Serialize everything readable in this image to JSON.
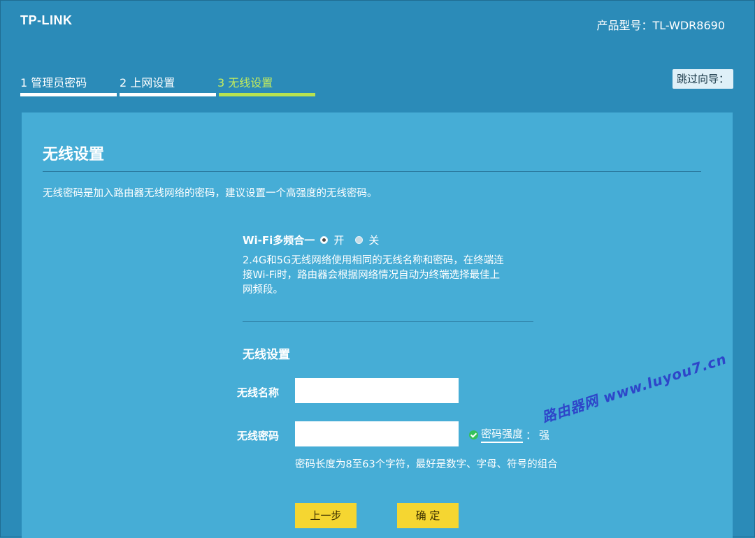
{
  "header": {
    "logo": "TP-LINK",
    "model": "产品型号：TL-WDR8690",
    "skip_label": "跳过向导："
  },
  "steps": [
    {
      "label": "1 管理员密码",
      "active": false
    },
    {
      "label": "2 上网设置",
      "active": false
    },
    {
      "label": "3 无线设置",
      "active": true
    }
  ],
  "panel": {
    "title": "无线设置",
    "description": "无线密码是加入路由器无线网络的密码，建议设置一个高强度的无线密码。",
    "wifi_merge": {
      "label": "Wi-Fi多频合一",
      "options": [
        {
          "label": "开",
          "checked": true
        },
        {
          "label": "关",
          "checked": false
        }
      ],
      "description": "2.4G和5G无线网络使用相同的无线名称和密码，在终端连接Wi-Fi时，路由器会根据网络情况自动为终端选择最佳上网频段。"
    },
    "wireless_section_title": "无线设置",
    "ssid": {
      "label": "无线名称",
      "value": ""
    },
    "password": {
      "label": "无线密码",
      "value": ""
    },
    "strength": {
      "key": "密码强度",
      "sep": "：",
      "value": "强"
    },
    "password_hint": "密码长度为8至63个字符，最好是数字、字母、符号的组合",
    "buttons": {
      "prev": "上一步",
      "confirm": "确 定"
    }
  },
  "watermark": "路由器网 www.luyou7.cn",
  "colors": {
    "background": "#2b8bb8",
    "panel": "#46add6",
    "active_step": "#c7ee5a",
    "button": "#f5d631",
    "strength_ok": "#35c15a",
    "watermark": "#2e46c9"
  }
}
